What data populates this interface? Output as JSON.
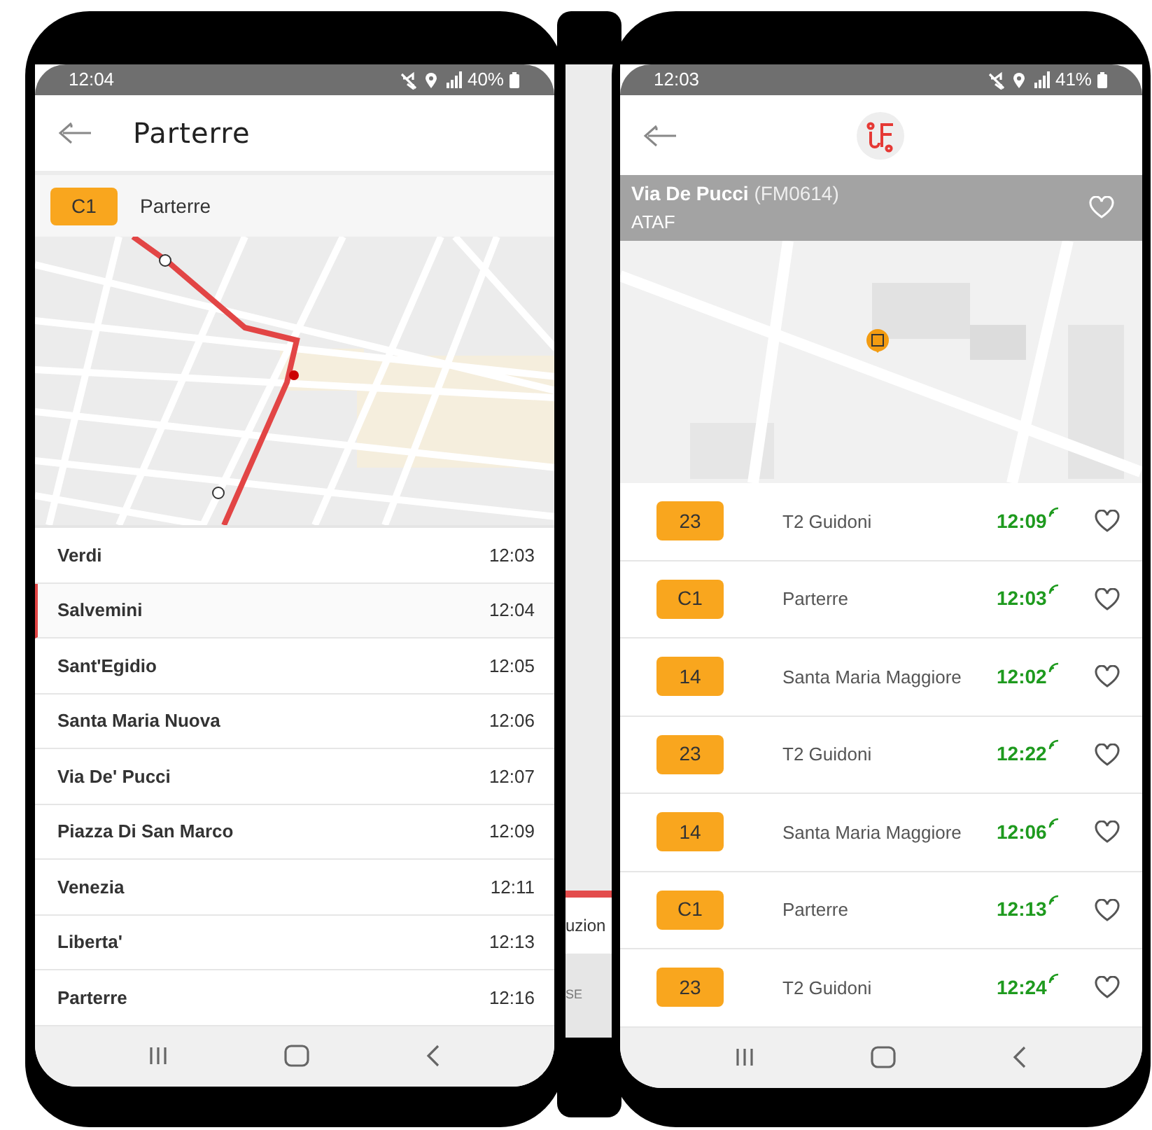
{
  "left_phone": {
    "status_bar": {
      "time": "12:04",
      "battery": "40%"
    },
    "header": {
      "title": "Parterre"
    },
    "route": {
      "line": "C1",
      "destination": "Parterre"
    },
    "stops": [
      {
        "name": "Verdi",
        "time": "12:03",
        "selected": false
      },
      {
        "name": "Salvemini",
        "time": "12:04",
        "selected": true
      },
      {
        "name": "Sant'Egidio",
        "time": "12:05",
        "selected": false
      },
      {
        "name": "Santa Maria Nuova",
        "time": "12:06",
        "selected": false
      },
      {
        "name": "Via De' Pucci",
        "time": "12:07",
        "selected": false
      },
      {
        "name": "Piazza Di San Marco",
        "time": "12:09",
        "selected": false
      },
      {
        "name": "Venezia",
        "time": "12:11",
        "selected": false
      },
      {
        "name": "Liberta'",
        "time": "12:13",
        "selected": false
      },
      {
        "name": "Parterre",
        "time": "12:16",
        "selected": false
      }
    ]
  },
  "middle_phone": {
    "partial_label": "uzion",
    "partial_button": "SE"
  },
  "right_phone": {
    "status_bar": {
      "time": "12:03",
      "battery": "41%"
    },
    "stop": {
      "name": "Via De Pucci",
      "code": "(FM0614)",
      "operator": "ATAF",
      "favorite": false
    },
    "departures": [
      {
        "line": "23",
        "destination": "T2 Guidoni",
        "time": "12:09",
        "live": true,
        "favorite": false
      },
      {
        "line": "C1",
        "destination": "Parterre",
        "time": "12:03",
        "live": true,
        "favorite": false
      },
      {
        "line": "14",
        "destination": "Santa Maria Maggiore",
        "time": "12:02",
        "live": true,
        "favorite": false
      },
      {
        "line": "23",
        "destination": "T2 Guidoni",
        "time": "12:22",
        "live": true,
        "favorite": false
      },
      {
        "line": "14",
        "destination": "Santa Maria Maggiore",
        "time": "12:06",
        "live": true,
        "favorite": false
      },
      {
        "line": "C1",
        "destination": "Parterre",
        "time": "12:13",
        "live": true,
        "favorite": false
      },
      {
        "line": "23",
        "destination": "T2 Guidoni",
        "time": "12:24",
        "live": true,
        "favorite": false
      }
    ]
  }
}
